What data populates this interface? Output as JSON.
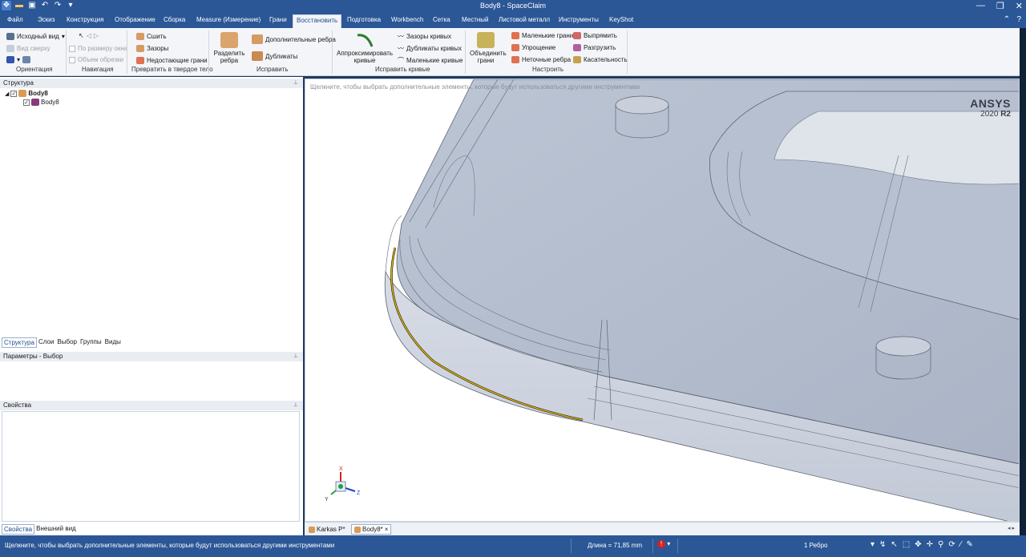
{
  "window": {
    "title": "Body8 - SpaceClaim",
    "controls": [
      "—",
      "❐",
      "✕"
    ]
  },
  "menu": {
    "tabs": [
      "Файл",
      "Эскиз",
      "Конструкция",
      "Отображение",
      "Сборка",
      "Measure (Измерение)",
      "Грани",
      "Восстановить",
      "Подготовка",
      "Workbench",
      "Сетка",
      "Местный",
      "Листовой металл",
      "Инструменты",
      "KeyShot"
    ],
    "active": "Восстановить",
    "help_icons": [
      "⌃",
      "?"
    ]
  },
  "ribbon": {
    "orientation": {
      "home_view": "Исходный вид",
      "top_view": "Вид сверху",
      "label": "Ориентация"
    },
    "navigation": {
      "fit_window": "По размеру окна",
      "clip_volume": "Объем обрезки",
      "label": "Навигация"
    },
    "solidify": {
      "stitch": "Сшить",
      "gaps": "Зазоры",
      "missing_faces": "Недостающие грани",
      "label": "Превратить в твердое тело"
    },
    "fix": {
      "split_edges": "Разделить ребра",
      "extra_edges": "Дополнительные ребра",
      "duplicates": "Дубликаты",
      "label": "Исправить"
    },
    "fix_curves": {
      "fit_curves": "Аппроксимировать кривые",
      "curve_gaps": "Зазоры кривых",
      "duplicate_curves": "Дубликаты кривых",
      "small_curves": "Маленькие кривые",
      "label": "Исправить кривые"
    },
    "adjust": {
      "merge_faces": "Объединить грани",
      "small_faces": "Маленькие грани",
      "simplify": "Упрощение",
      "inexact_edges": "Неточные ребра",
      "straighten": "Выпрямить",
      "relax": "Разгрузить",
      "tangency": "Касательность",
      "label": "Настроить"
    }
  },
  "structure": {
    "header": "Структура",
    "root": "Body8",
    "child": "Body8",
    "tabs": [
      "Структура",
      "Слои",
      "Выбор",
      "Группы",
      "Виды"
    ],
    "active_tab": "Структура"
  },
  "options": {
    "header": "Параметры - Выбор"
  },
  "properties": {
    "header": "Свойства",
    "tabs": [
      "Свойства",
      "Внешний вид"
    ],
    "active_tab": "Свойства"
  },
  "viewport": {
    "hint": "Щелкните, чтобы выбрать дополнительные элементы, которые будут использоваться другими инструментами",
    "brand": "ANSYS",
    "version": "2020 ",
    "release": "R2",
    "triad": {
      "x": "X",
      "y": "Y",
      "z": "Z"
    }
  },
  "documents": {
    "tabs": [
      "Karkas P*",
      "Body8*"
    ],
    "active": "Body8*",
    "close": "×"
  },
  "status": {
    "message": "Щелкните, чтобы выбрать дополнительные элементы, которые будут использоваться другими инструментами",
    "length": "Длина = 71,85 mm",
    "selection": "1 Ребро"
  },
  "colors": {
    "frame": "#2b5797",
    "ribbon": "#f3f5f8",
    "selection_edge": "#e8b800",
    "model_fill": "#c4ccd9"
  }
}
